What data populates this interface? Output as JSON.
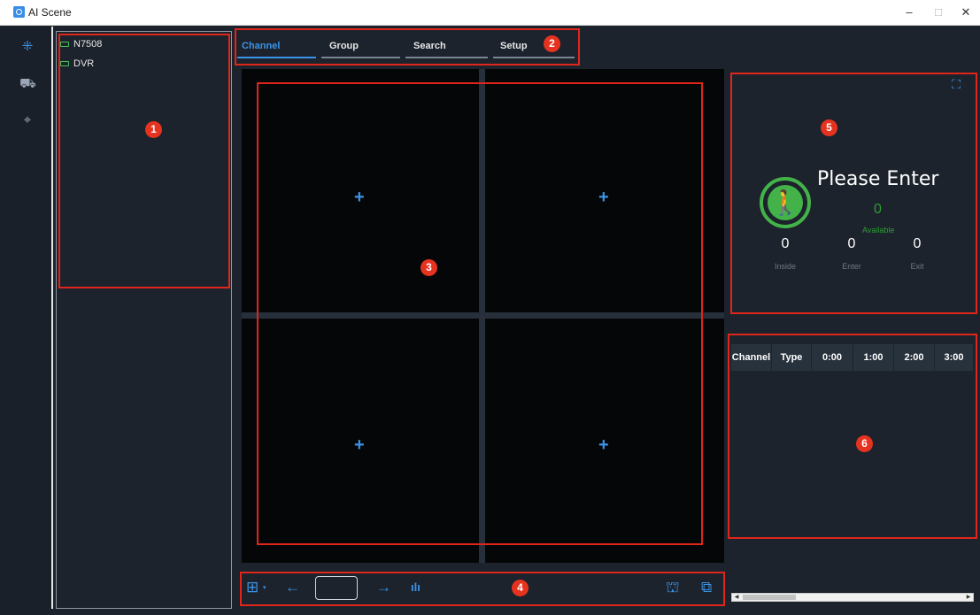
{
  "window": {
    "title": "AI Scene",
    "controls": {
      "minimize": "–",
      "maximize": "□",
      "close": "✕"
    }
  },
  "rail": {
    "items": [
      {
        "icon": "channel-view-icon",
        "glyph": "⁜",
        "active": true
      },
      {
        "icon": "vehicle-icon",
        "glyph": "⛟",
        "active": false
      },
      {
        "icon": "face-scan-icon",
        "glyph": "⌖",
        "active": false
      }
    ]
  },
  "tree": {
    "items": [
      {
        "label": "N7508",
        "icon": "device-icon"
      },
      {
        "label": "DVR",
        "icon": "device-icon"
      }
    ]
  },
  "tabs": [
    {
      "label": "Channel",
      "active": true
    },
    {
      "label": "Group",
      "active": false
    },
    {
      "label": "Search",
      "active": false
    },
    {
      "label": "Setup",
      "active": false
    }
  ],
  "grid": {
    "cells": [
      {
        "label": "+"
      },
      {
        "label": "+"
      },
      {
        "label": "+"
      },
      {
        "label": "+"
      }
    ]
  },
  "toolbar": {
    "layout_glyph": "⊞",
    "prev_glyph": "←",
    "page_value": "",
    "next_glyph": "→",
    "stats_glyph": "ılı",
    "clear_glyph": "⛫",
    "snapshot_glyph": "⧉"
  },
  "counting": {
    "fullscreen_glyph": "⛶",
    "walker_glyph": "🚶",
    "status": "Please Enter",
    "available_value": "0",
    "available_label": "Available",
    "stats": [
      {
        "value": "0",
        "label": "Inside"
      },
      {
        "value": "0",
        "label": "Enter"
      },
      {
        "value": "0",
        "label": "Exit"
      }
    ]
  },
  "stats_table": {
    "headers": [
      "Channel",
      "Type",
      "0:00",
      "1:00",
      "2:00",
      "3:00"
    ]
  },
  "annotations": [
    "1",
    "2",
    "3",
    "4",
    "5",
    "6"
  ],
  "colors": {
    "background": "#1c232c",
    "accent": "#3a93e8",
    "status_green": "#43b349",
    "annotation_red": "#e0261a"
  }
}
